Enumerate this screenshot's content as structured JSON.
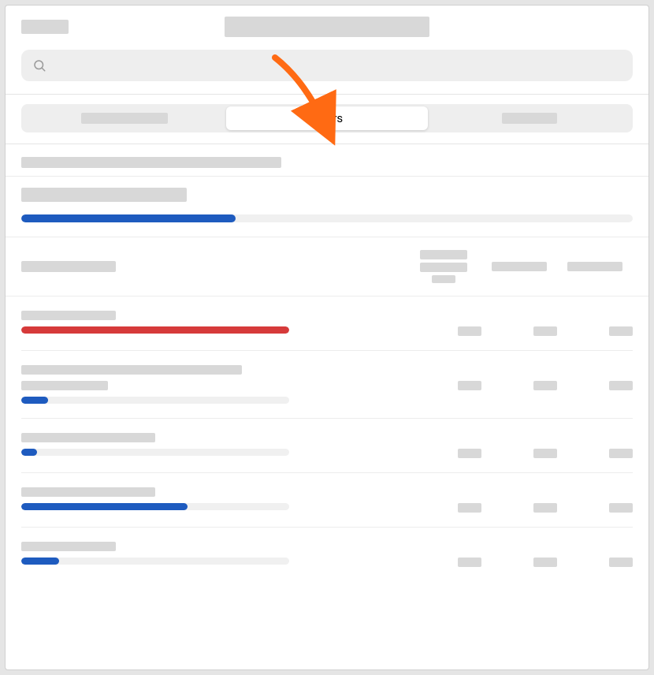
{
  "header": {
    "left_placeholder": "",
    "title_placeholder": "",
    "search_placeholder": ""
  },
  "tabs": {
    "items": [
      {
        "label": "",
        "active": false
      },
      {
        "label": "Hours",
        "active": true
      },
      {
        "label": "",
        "active": false
      }
    ]
  },
  "overall": {
    "title": "",
    "progress_percent": 35,
    "progress_color": "blue"
  },
  "columns": {
    "label": "",
    "headers": [
      "",
      "",
      ""
    ]
  },
  "rows": [
    {
      "title_lines": [
        120
      ],
      "bar_percent": 100,
      "bar_color": "red",
      "track_width": 340,
      "values": [
        "",
        "",
        ""
      ]
    },
    {
      "title_lines": [
        280,
        110
      ],
      "bar_percent": 10,
      "bar_color": "blue",
      "track_width": 340,
      "values": [
        "",
        "",
        ""
      ]
    },
    {
      "title_lines": [
        170
      ],
      "bar_percent": 6,
      "bar_color": "blue",
      "track_width": 340,
      "values": [
        "",
        "",
        ""
      ]
    },
    {
      "title_lines": [
        170
      ],
      "bar_percent": 62,
      "bar_color": "blue",
      "track_width": 340,
      "values": [
        "",
        "",
        ""
      ]
    },
    {
      "title_lines": [
        120
      ],
      "bar_percent": 14,
      "bar_color": "blue",
      "track_width": 340,
      "values": [
        "",
        "",
        ""
      ]
    }
  ],
  "annotation": {
    "points_to": "tab-hours",
    "color": "#ff6a13"
  }
}
